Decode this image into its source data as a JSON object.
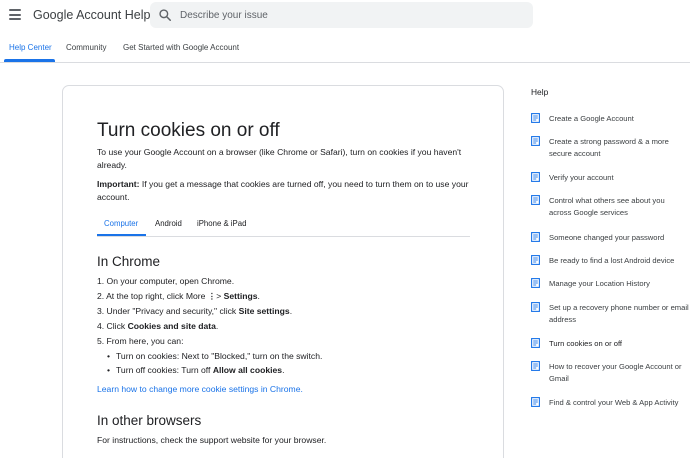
{
  "header": {
    "app_title": "Google Account Help",
    "search_placeholder": "Describe your issue",
    "menu_icon": "hamburger-menu-icon",
    "search_icon": "search-icon"
  },
  "nav": {
    "tabs": [
      {
        "label": "Help Center",
        "active": true
      },
      {
        "label": "Community",
        "active": false
      },
      {
        "label": "Get Started with Google Account",
        "active": false
      }
    ]
  },
  "article": {
    "title": "Turn cookies on or off",
    "intro": "To use your Google Account on a browser (like Chrome or Safari), turn on cookies if you haven't already.",
    "important_label": "Important:",
    "important_text": " If you get a message that cookies are turned off, you need to turn them on to use your account.",
    "content_tabs": [
      {
        "label": "Computer",
        "active": true
      },
      {
        "label": "Android",
        "active": false
      },
      {
        "label": "iPhone & iPad",
        "active": false
      }
    ],
    "chrome": {
      "heading": "In Chrome",
      "step1": "1. On your computer, open Chrome.",
      "step2_pre": "2. At the top right, click More ",
      "step2_more_icon": "⋮",
      "step2_arrow": " > ",
      "step2_bold": "Settings",
      "step2_post": ".",
      "step3_pre": "3. Under \"Privacy and security,\" click ",
      "step3_bold": "Site settings",
      "step3_post": ".",
      "step4_pre": "4. Click ",
      "step4_bold": "Cookies and site data",
      "step4_post": ".",
      "step5": "5. From here, you can:",
      "sub1": "Turn on cookies: Next to \"Blocked,\" turn on the switch.",
      "sub2_pre": "Turn off cookies: Turn off ",
      "sub2_bold": "Allow all cookies",
      "sub2_post": ".",
      "bullet": "•",
      "learn_link": "Learn how to change more cookie settings in Chrome."
    },
    "other": {
      "heading": "In other browsers",
      "text": "For instructions, check the support website for your browser."
    }
  },
  "sidebar": {
    "heading": "Help",
    "doc_icon": "article-icon",
    "items": [
      {
        "label": "Create a Google Account"
      },
      {
        "label": "Create a strong password & a more secure account"
      },
      {
        "label": "Verify your account"
      },
      {
        "label": "Control what others see about you across Google services"
      },
      {
        "label": "Someone changed your password"
      },
      {
        "label": "Be ready to find a lost Android device"
      },
      {
        "label": "Manage your Location History"
      },
      {
        "label": "Set up a recovery phone number or email address"
      },
      {
        "label": "Turn cookies on or off",
        "current": true
      },
      {
        "label": "How to recover your Google Account or Gmail"
      },
      {
        "label": "Find & control your Web & App Activity"
      }
    ]
  },
  "colors": {
    "accent": "#1a73e8",
    "text": "#202124",
    "divider": "#dadce0",
    "search_bg": "#f1f3f4"
  }
}
